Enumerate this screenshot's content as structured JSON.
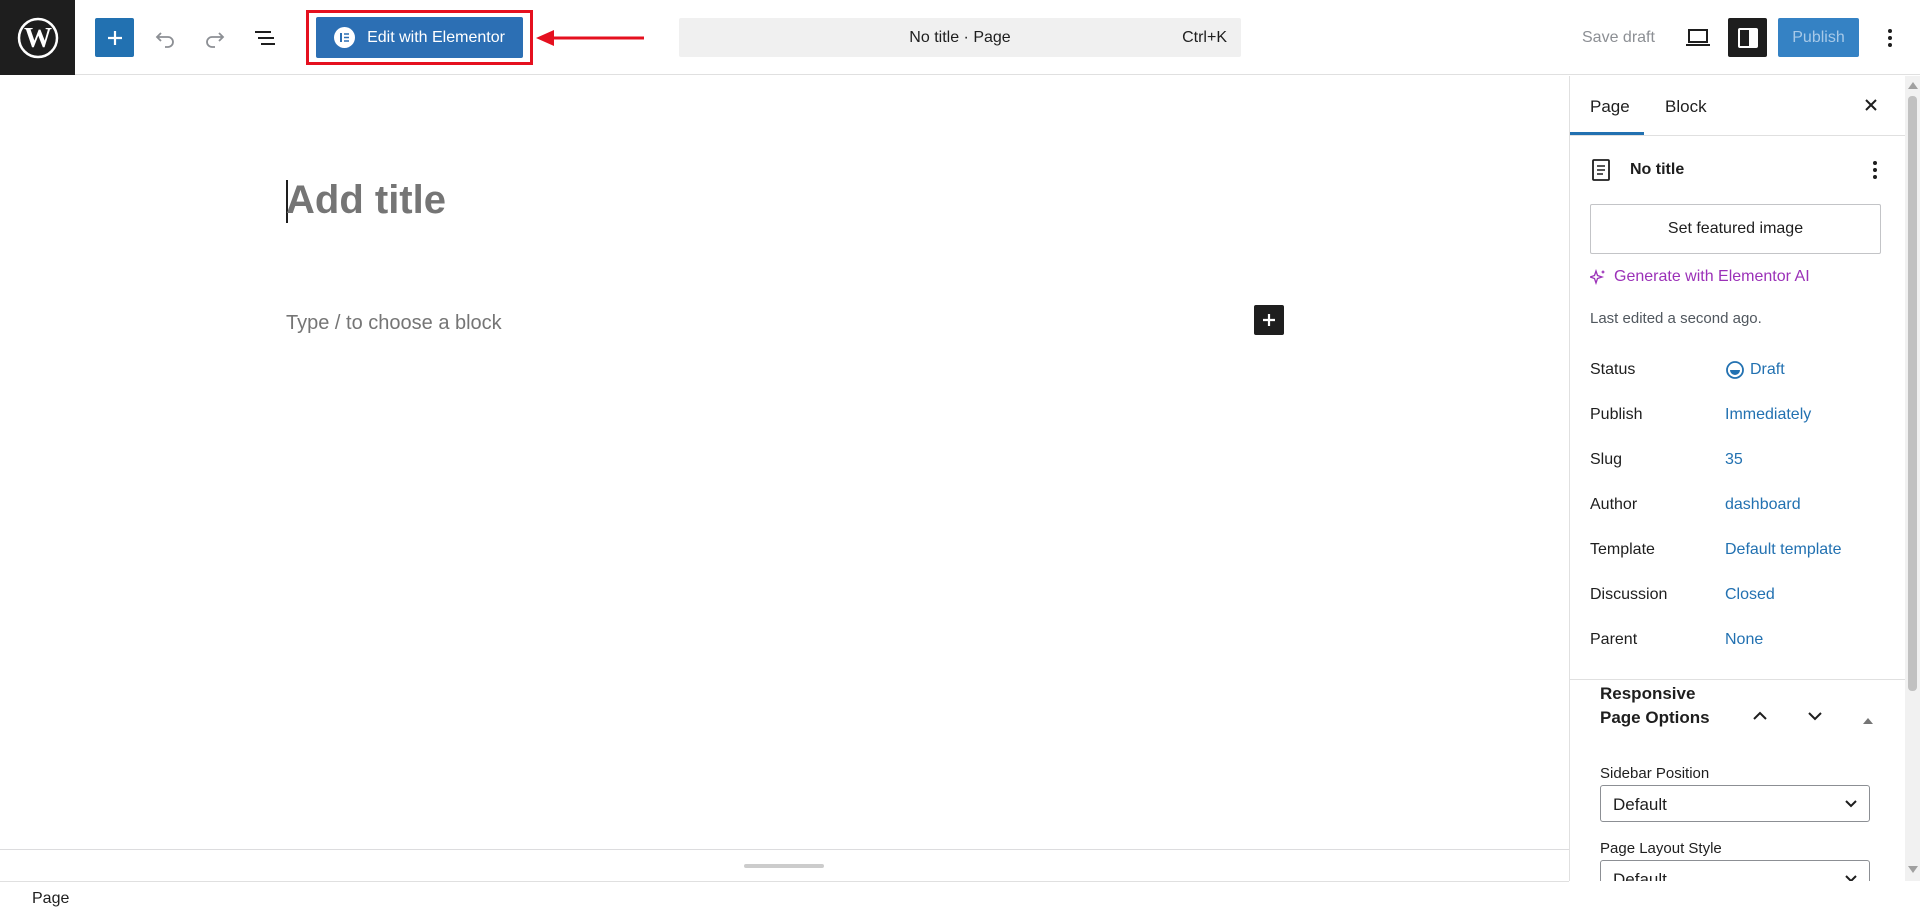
{
  "topbar": {
    "elementor_label": "Edit with Elementor",
    "command_title": "No title · Page",
    "command_shortcut": "Ctrl+K",
    "save_draft": "Save draft",
    "publish": "Publish"
  },
  "editor": {
    "title_placeholder": "Add title",
    "block_placeholder": "Type / to choose a block",
    "footer_breadcrumb": "Page"
  },
  "sidebar": {
    "tabs": [
      {
        "label": "Page"
      },
      {
        "label": "Block"
      }
    ],
    "doc_title": "No title",
    "featured_image": "Set featured image",
    "ai_link": "Generate with Elementor AI",
    "last_edited": "Last edited a second ago.",
    "properties": [
      {
        "key": "Status",
        "value": "Draft"
      },
      {
        "key": "Publish",
        "value": "Immediately"
      },
      {
        "key": "Slug",
        "value": "35"
      },
      {
        "key": "Author",
        "value": "dashboard"
      },
      {
        "key": "Template",
        "value": "Default template"
      },
      {
        "key": "Discussion",
        "value": "Closed"
      },
      {
        "key": "Parent",
        "value": "None"
      }
    ],
    "panel_title": "Responsive Page Options",
    "sidebar_position_label": "Sidebar Position",
    "sidebar_position_value": "Default",
    "page_layout_label": "Page Layout Style",
    "page_layout_value": "Default"
  },
  "colors": {
    "accent": "#2271b1",
    "highlight": "#e5101f",
    "ai": "#9b31b8"
  }
}
